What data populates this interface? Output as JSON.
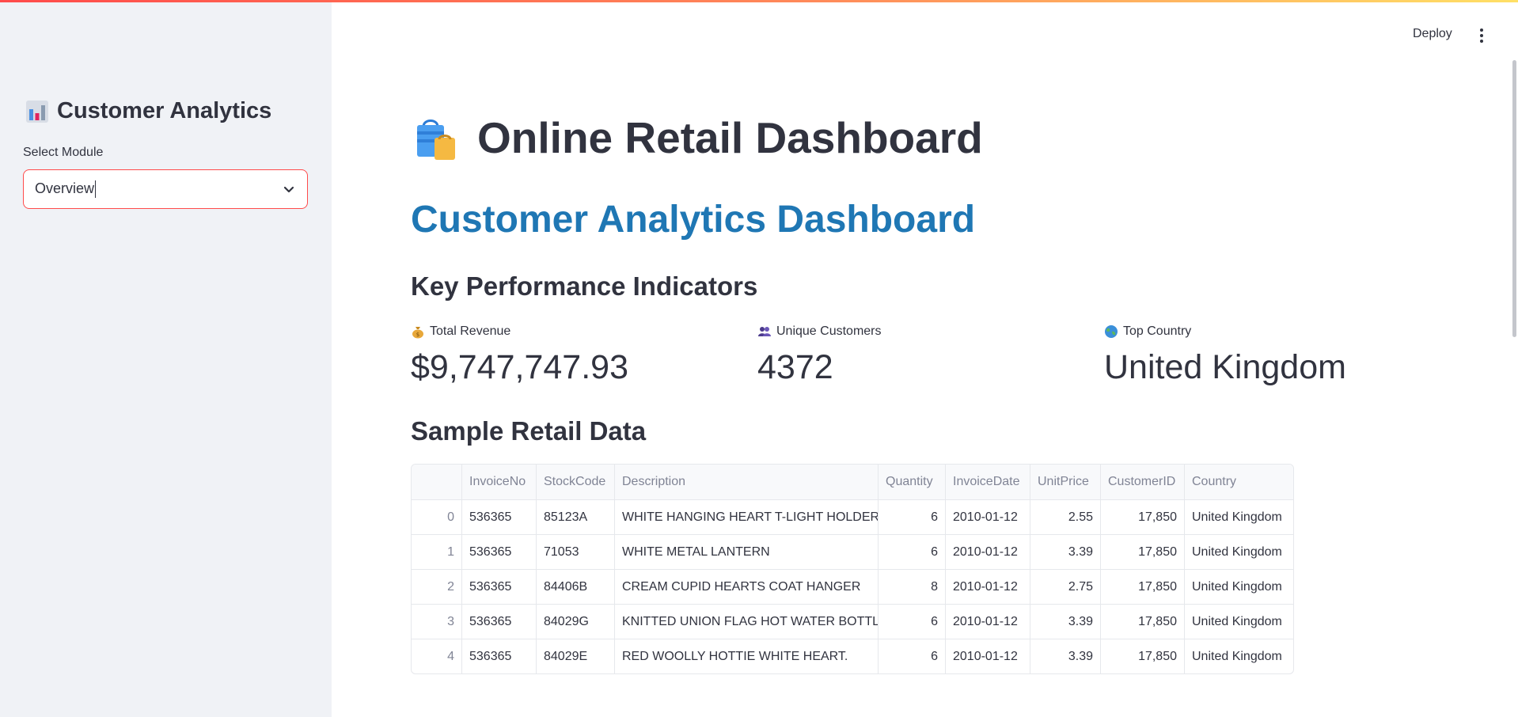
{
  "app": {
    "deploy_label": "Deploy",
    "menu_icon": "kebab-menu-icon"
  },
  "sidebar": {
    "title": "Customer Analytics",
    "title_icon": "bar-chart-icon",
    "select_label": "Select Module",
    "select_value": "Overview"
  },
  "main": {
    "title": "Online Retail Dashboard",
    "title_icon": "shopping-bags-icon",
    "subtitle": "Customer Analytics Dashboard",
    "subtitle_color": "#1f77b4",
    "kpi_heading": "Key Performance Indicators",
    "metrics": [
      {
        "icon": "money-bag-icon",
        "label": "Total Revenue",
        "value": "$9,747,747.93"
      },
      {
        "icon": "people-icon",
        "label": "Unique Customers",
        "value": "4372"
      },
      {
        "icon": "globe-icon",
        "label": "Top Country",
        "value": "United Kingdom"
      }
    ],
    "sample_heading": "Sample Retail Data"
  },
  "table": {
    "columns": [
      "",
      "InvoiceNo",
      "StockCode",
      "Description",
      "Quantity",
      "InvoiceDate",
      "UnitPrice",
      "CustomerID",
      "Country"
    ],
    "rows": [
      [
        "0",
        "536365",
        "85123A",
        "WHITE HANGING HEART T-LIGHT HOLDER",
        "6",
        "2010-01-12",
        "2.55",
        "17,850",
        "United Kingdom"
      ],
      [
        "1",
        "536365",
        "71053",
        "WHITE METAL LANTERN",
        "6",
        "2010-01-12",
        "3.39",
        "17,850",
        "United Kingdom"
      ],
      [
        "2",
        "536365",
        "84406B",
        "CREAM CUPID HEARTS COAT HANGER",
        "8",
        "2010-01-12",
        "2.75",
        "17,850",
        "United Kingdom"
      ],
      [
        "3",
        "536365",
        "84029G",
        "KNITTED UNION FLAG HOT WATER BOTTLE",
        "6",
        "2010-01-12",
        "3.39",
        "17,850",
        "United Kingdom"
      ],
      [
        "4",
        "536365",
        "84029E",
        "RED WOOLLY HOTTIE WHITE HEART.",
        "6",
        "2010-01-12",
        "3.39",
        "17,850",
        "United Kingdom"
      ]
    ]
  },
  "colors": {
    "accent": "#ff4b4b",
    "sidebar_bg": "#f0f2f6",
    "text": "#31333f"
  }
}
